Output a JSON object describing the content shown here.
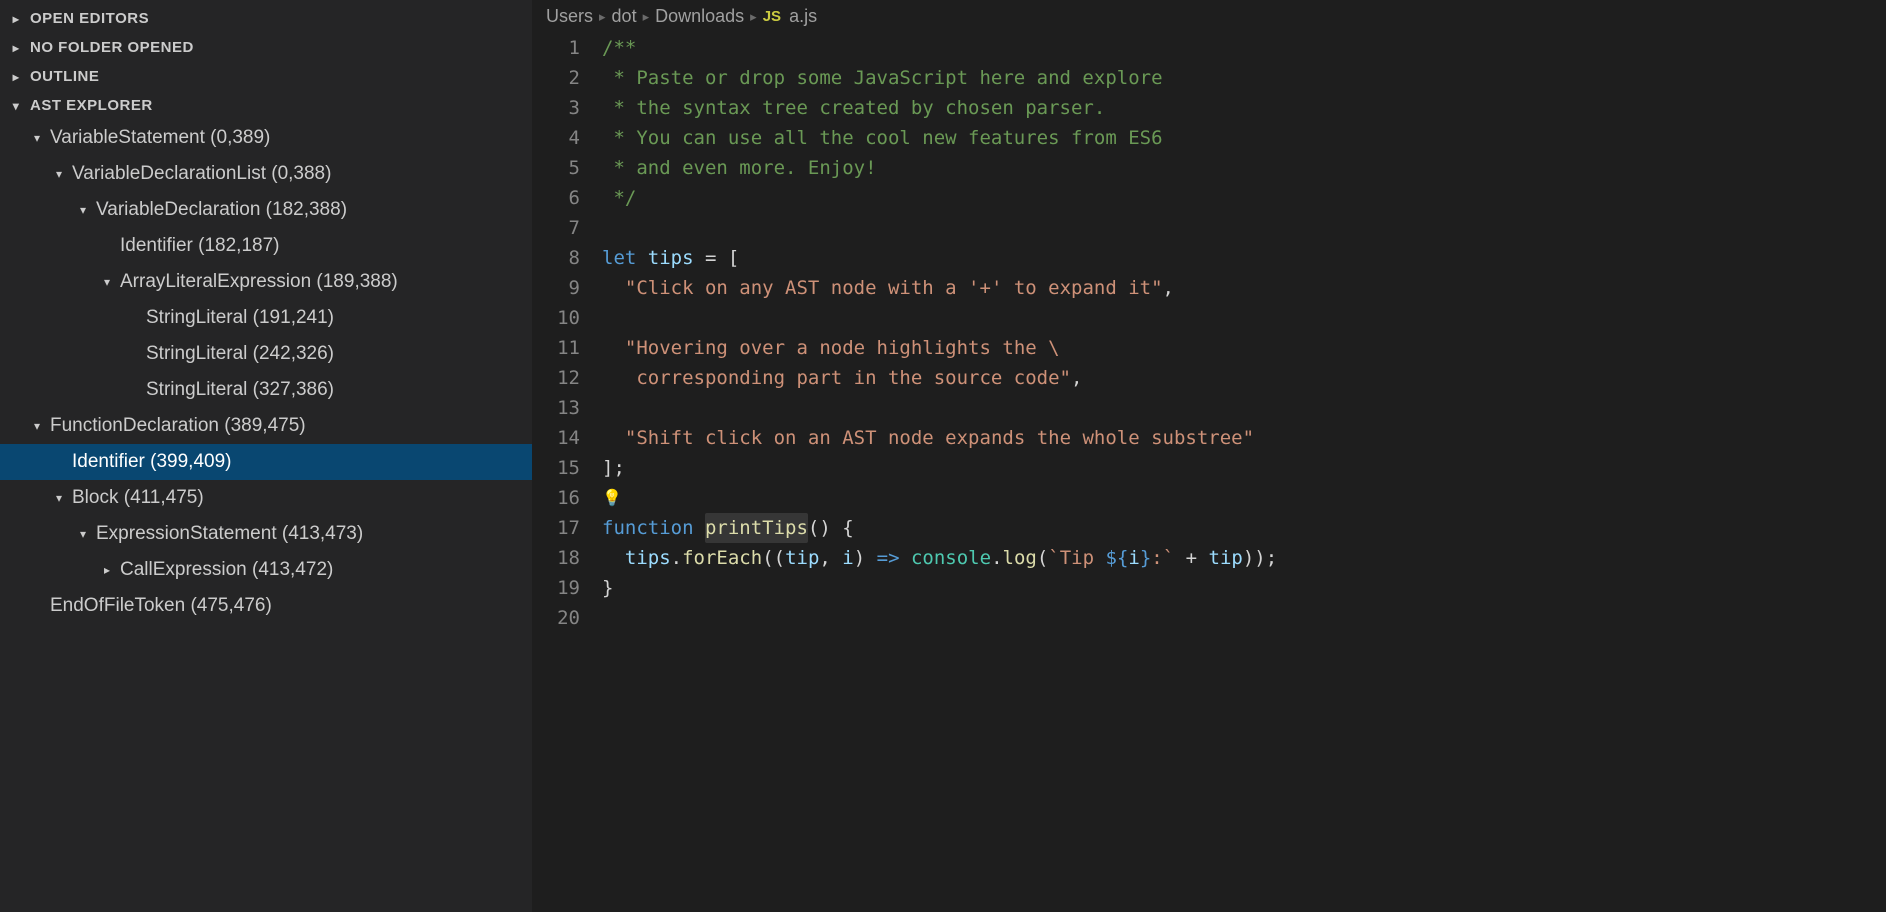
{
  "sidebar": {
    "panels": [
      {
        "label": "OPEN EDITORS",
        "expanded": false
      },
      {
        "label": "NO FOLDER OPENED",
        "expanded": false
      },
      {
        "label": "OUTLINE",
        "expanded": false
      },
      {
        "label": "AST EXPLORER",
        "expanded": true
      }
    ],
    "tree": [
      {
        "indent": 0,
        "twistie": "down",
        "label": "VariableStatement (0,389)",
        "selected": false
      },
      {
        "indent": 1,
        "twistie": "down",
        "label": "VariableDeclarationList (0,388)",
        "selected": false
      },
      {
        "indent": 2,
        "twistie": "down",
        "label": "VariableDeclaration (182,388)",
        "selected": false
      },
      {
        "indent": 3,
        "twistie": "none",
        "label": "Identifier (182,187)",
        "selected": false
      },
      {
        "indent": 3,
        "twistie": "down",
        "label": "ArrayLiteralExpression (189,388)",
        "selected": false
      },
      {
        "indent": 4,
        "twistie": "none",
        "label": "StringLiteral (191,241)",
        "selected": false
      },
      {
        "indent": 4,
        "twistie": "none",
        "label": "StringLiteral (242,326)",
        "selected": false
      },
      {
        "indent": 4,
        "twistie": "none",
        "label": "StringLiteral (327,386)",
        "selected": false
      },
      {
        "indent": 0,
        "twistie": "down",
        "label": "FunctionDeclaration (389,475)",
        "selected": false
      },
      {
        "indent": 1,
        "twistie": "none",
        "label": "Identifier (399,409)",
        "selected": true
      },
      {
        "indent": 1,
        "twistie": "down",
        "label": "Block (411,475)",
        "selected": false
      },
      {
        "indent": 2,
        "twistie": "down",
        "label": "ExpressionStatement (413,473)",
        "selected": false
      },
      {
        "indent": 3,
        "twistie": "right",
        "label": "CallExpression (413,472)",
        "selected": false
      },
      {
        "indent": 0,
        "twistie": "none",
        "label": "EndOfFileToken (475,476)",
        "selected": false
      }
    ]
  },
  "breadcrumb": {
    "items": [
      "Users",
      "dot",
      "Downloads"
    ],
    "file_badge": "JS",
    "file_name": "a.js"
  },
  "code": {
    "lines": [
      {
        "n": 1,
        "tokens": [
          {
            "t": "/**",
            "c": "comment"
          }
        ]
      },
      {
        "n": 2,
        "tokens": [
          {
            "t": " * Paste or drop some JavaScript here and explore",
            "c": "comment"
          }
        ]
      },
      {
        "n": 3,
        "tokens": [
          {
            "t": " * the syntax tree created by chosen parser.",
            "c": "comment"
          }
        ]
      },
      {
        "n": 4,
        "tokens": [
          {
            "t": " * You can use all the cool new features from ES6",
            "c": "comment"
          }
        ]
      },
      {
        "n": 5,
        "tokens": [
          {
            "t": " * and even more. Enjoy!",
            "c": "comment"
          }
        ]
      },
      {
        "n": 6,
        "tokens": [
          {
            "t": " */",
            "c": "comment"
          }
        ]
      },
      {
        "n": 7,
        "tokens": []
      },
      {
        "n": 8,
        "tokens": [
          {
            "t": "let ",
            "c": "keyword"
          },
          {
            "t": "tips",
            "c": "ident"
          },
          {
            "t": " = [",
            "c": "punct"
          }
        ]
      },
      {
        "n": 9,
        "tokens": [
          {
            "t": "  ",
            "c": "punct"
          },
          {
            "t": "\"Click on any AST node with a '+' to expand it\"",
            "c": "string"
          },
          {
            "t": ",",
            "c": "punct"
          }
        ]
      },
      {
        "n": 10,
        "tokens": []
      },
      {
        "n": 11,
        "tokens": [
          {
            "t": "  ",
            "c": "punct"
          },
          {
            "t": "\"Hovering over a node highlights the \\",
            "c": "string"
          }
        ]
      },
      {
        "n": 12,
        "tokens": [
          {
            "t": "   corresponding part in the source code\"",
            "c": "string"
          },
          {
            "t": ",",
            "c": "punct"
          }
        ]
      },
      {
        "n": 13,
        "tokens": []
      },
      {
        "n": 14,
        "tokens": [
          {
            "t": "  ",
            "c": "punct"
          },
          {
            "t": "\"Shift click on an AST node expands the whole substree\"",
            "c": "string"
          }
        ]
      },
      {
        "n": 15,
        "tokens": [
          {
            "t": "];",
            "c": "punct"
          }
        ]
      },
      {
        "n": 16,
        "tokens": [
          {
            "t": "bulb",
            "c": "bulb"
          }
        ]
      },
      {
        "n": 17,
        "tokens": [
          {
            "t": "function",
            "c": "keyword"
          },
          {
            "t": " ",
            "c": "punct"
          },
          {
            "t": "printTips",
            "c": "func",
            "hl": true
          },
          {
            "t": "() {",
            "c": "punct"
          }
        ]
      },
      {
        "n": 18,
        "tokens": [
          {
            "t": "  ",
            "c": "punct"
          },
          {
            "t": "tips",
            "c": "ident"
          },
          {
            "t": ".",
            "c": "punct"
          },
          {
            "t": "forEach",
            "c": "func"
          },
          {
            "t": "((",
            "c": "punct"
          },
          {
            "t": "tip",
            "c": "param"
          },
          {
            "t": ", ",
            "c": "punct"
          },
          {
            "t": "i",
            "c": "param"
          },
          {
            "t": ") ",
            "c": "punct"
          },
          {
            "t": "=>",
            "c": "keyword"
          },
          {
            "t": " ",
            "c": "punct"
          },
          {
            "t": "console",
            "c": "obj"
          },
          {
            "t": ".",
            "c": "punct"
          },
          {
            "t": "log",
            "c": "func"
          },
          {
            "t": "(",
            "c": "punct"
          },
          {
            "t": "`Tip ",
            "c": "string"
          },
          {
            "t": "${",
            "c": "interp"
          },
          {
            "t": "i",
            "c": "ident"
          },
          {
            "t": "}",
            "c": "interp"
          },
          {
            "t": ":`",
            "c": "string"
          },
          {
            "t": " + ",
            "c": "op"
          },
          {
            "t": "tip",
            "c": "ident"
          },
          {
            "t": "));",
            "c": "punct"
          }
        ]
      },
      {
        "n": 19,
        "tokens": [
          {
            "t": "}",
            "c": "punct"
          }
        ]
      },
      {
        "n": 20,
        "tokens": []
      }
    ]
  }
}
